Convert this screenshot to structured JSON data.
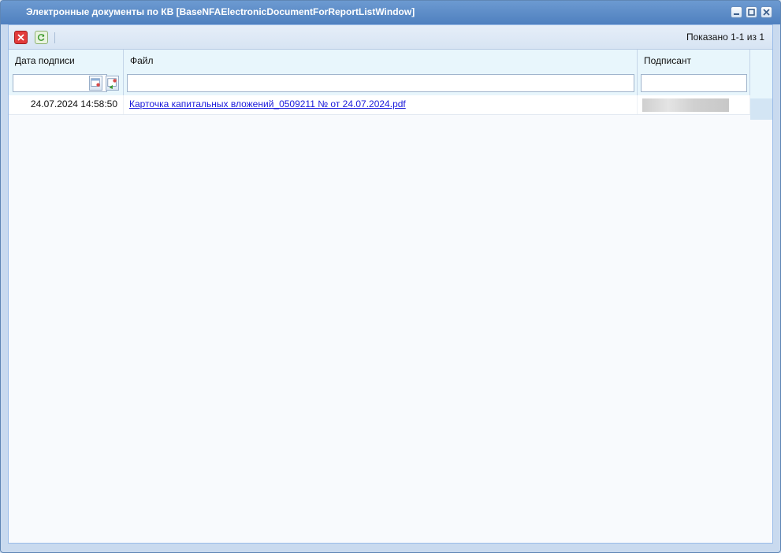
{
  "window": {
    "title": "Электронные документы по КВ [BaseNFAElectronicDocumentForReportListWindow]",
    "buttons": [
      "minimize-icon",
      "maximize-icon",
      "close-icon"
    ]
  },
  "toolbar": {
    "close_icon": "close-icon",
    "refresh_icon": "refresh-icon",
    "paging": "Показано 1-1 из 1"
  },
  "grid": {
    "columns": [
      "Дата подписи",
      "Файл",
      "Подписант"
    ],
    "filters": {
      "date": "",
      "file": "",
      "signer": ""
    },
    "rows": [
      {
        "date": "24.07.2024 14:58:50",
        "file": "Карточка капитальных вложений_0509211 № от 24.07.2024.pdf",
        "signer": ""
      }
    ]
  },
  "colors": {
    "title_bar": "#4f80bf",
    "header_bg": "#e8f6fc",
    "link": "#1a1adb",
    "close_button": "#e23b3b"
  }
}
